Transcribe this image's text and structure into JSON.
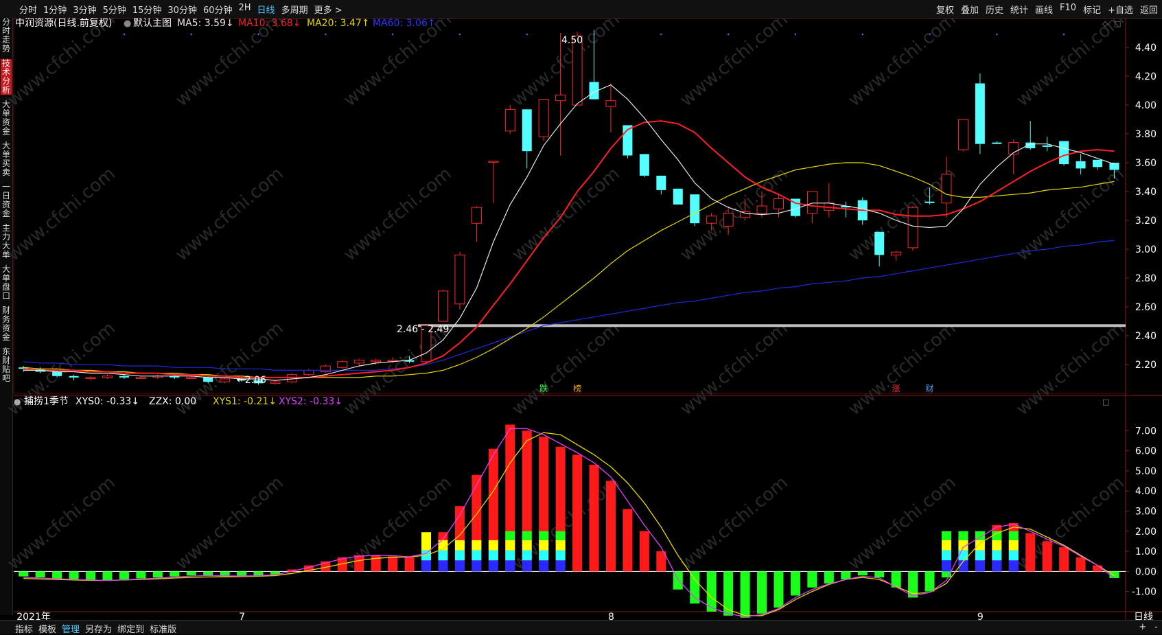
{
  "toolbar": {
    "left": [
      "分时",
      "1分钟",
      "3分钟",
      "5分钟",
      "15分钟",
      "30分钟",
      "60分钟",
      "2H",
      "日线",
      "多周期",
      "更多 >"
    ],
    "active": "日线",
    "right": [
      "复权",
      "叠加",
      "历史",
      "统计",
      "画线",
      "F10",
      "标记",
      "+自选",
      "返回"
    ]
  },
  "sidebar": [
    "分时走势",
    "技术分析",
    "大单资金",
    "大单买卖",
    "一日资金",
    "主力大单",
    "大单盘口",
    "财务资金",
    "东财贴吧"
  ],
  "sidebar_active": "技术分析",
  "bottom": {
    "left": [
      "指标",
      "模板",
      "管理",
      "另存为",
      "绑定到",
      "标准版"
    ],
    "active": "管理",
    "right_icons": [
      "+",
      "-"
    ]
  },
  "colors": {
    "up": "#ff2a2a",
    "down": "#54ffff",
    "ma5": "#e6e6e6",
    "ma10": "#ff2020",
    "ma20": "#e8d800",
    "ma60": "#1c2bd8",
    "xys1": "#e8d800",
    "xys2": "#e040fb",
    "grid": "#3a0f0f",
    "axis": "#8a1a1a"
  },
  "main_legend": {
    "name": "中润资源(日线.前复权)",
    "template": "默认主图",
    "ma5": "MA5: 3.59↓",
    "ma10": "MA10: 3.68↓",
    "ma20": "MA20: 3.47↑",
    "ma60": "MA60: 3.06↑"
  },
  "sub_legend": {
    "name": "捕捞1季节",
    "xys0": "XYS0: -0.33↓",
    "zzx": "ZZX: 0.00",
    "xys1": "XYS1: -0.21↓",
    "xys2": "XYS2: -0.33↓"
  },
  "annotations": {
    "high": "4.50",
    "low": "←2.06",
    "band": "2.46 - 2.49"
  },
  "event_markers": [
    {
      "idx": 31,
      "text": "跌",
      "color": "#33ff33"
    },
    {
      "idx": 33,
      "text": "榜",
      "color": "#ffaa00"
    },
    {
      "idx": 52,
      "text": "涨",
      "color": "#ff3333"
    },
    {
      "idx": 54,
      "text": "财",
      "color": "#4c9fff"
    }
  ],
  "watermark": "www.cfchi.com",
  "chart_data": {
    "type": "candlestick",
    "x_labels": [
      {
        "idx": 0,
        "text": "2021年"
      },
      {
        "idx": 13,
        "text": "7"
      },
      {
        "idx": 35,
        "text": "8"
      },
      {
        "idx": 57,
        "text": "9"
      }
    ],
    "period_label": "日线",
    "main_ylim": [
      2.0,
      4.5
    ],
    "main_yticks": [
      2.2,
      2.4,
      2.6,
      2.8,
      3.0,
      3.2,
      3.4,
      3.6,
      3.8,
      4.0,
      4.2,
      4.4
    ],
    "sub_ylim": [
      -1.9,
      8.0
    ],
    "sub_yticks": [
      -1.0,
      0.0,
      1.0,
      2.0,
      3.0,
      4.0,
      5.0,
      6.0,
      7.0
    ],
    "band_price": 2.47,
    "ohlc": [
      [
        2.18,
        2.19,
        2.15,
        2.17
      ],
      [
        2.17,
        2.18,
        2.14,
        2.15
      ],
      [
        2.15,
        2.16,
        2.11,
        2.12
      ],
      [
        2.12,
        2.13,
        2.09,
        2.11
      ],
      [
        2.11,
        2.12,
        2.09,
        2.11
      ],
      [
        2.11,
        2.13,
        2.1,
        2.12
      ],
      [
        2.12,
        2.13,
        2.1,
        2.11
      ],
      [
        2.11,
        2.12,
        2.1,
        2.11
      ],
      [
        2.11,
        2.13,
        2.1,
        2.12
      ],
      [
        2.12,
        2.13,
        2.1,
        2.11
      ],
      [
        2.11,
        2.12,
        2.1,
        2.11
      ],
      [
        2.11,
        2.12,
        2.07,
        2.08
      ],
      [
        2.08,
        2.11,
        2.07,
        2.1
      ],
      [
        2.1,
        2.11,
        2.08,
        2.09
      ],
      [
        2.09,
        2.1,
        2.06,
        2.07
      ],
      [
        2.07,
        2.09,
        2.06,
        2.08
      ],
      [
        2.08,
        2.14,
        2.07,
        2.13
      ],
      [
        2.13,
        2.17,
        2.12,
        2.16
      ],
      [
        2.15,
        2.2,
        2.14,
        2.19
      ],
      [
        2.18,
        2.23,
        2.17,
        2.22
      ],
      [
        2.21,
        2.24,
        2.19,
        2.23
      ],
      [
        2.22,
        2.24,
        2.2,
        2.23
      ],
      [
        2.23,
        2.25,
        2.21,
        2.23
      ],
      [
        2.23,
        2.26,
        2.21,
        2.22
      ],
      [
        2.22,
        2.47,
        2.21,
        2.47
      ],
      [
        2.5,
        2.72,
        2.5,
        2.71
      ],
      [
        2.62,
        2.98,
        2.58,
        2.96
      ],
      [
        3.18,
        3.3,
        3.05,
        3.29
      ],
      [
        3.61,
        3.61,
        3.32,
        3.61
      ],
      [
        3.82,
        4.0,
        3.8,
        3.97
      ],
      [
        3.97,
        3.97,
        3.56,
        3.68
      ],
      [
        3.78,
        4.04,
        3.75,
        4.04
      ],
      [
        4.03,
        4.5,
        3.65,
        4.07
      ],
      [
        4.0,
        4.51,
        4.0,
        4.48
      ],
      [
        4.16,
        4.52,
        4.04,
        4.04
      ],
      [
        3.99,
        4.15,
        3.81,
        4.03
      ],
      [
        3.86,
        3.86,
        3.63,
        3.65
      ],
      [
        3.66,
        3.66,
        3.5,
        3.51
      ],
      [
        3.51,
        3.51,
        3.38,
        3.41
      ],
      [
        3.42,
        3.42,
        3.33,
        3.31
      ],
      [
        3.38,
        3.38,
        3.16,
        3.18
      ],
      [
        3.18,
        3.25,
        3.13,
        3.23
      ],
      [
        3.16,
        3.3,
        3.1,
        3.25
      ],
      [
        3.22,
        3.35,
        3.2,
        3.26
      ],
      [
        3.25,
        3.4,
        3.22,
        3.3
      ],
      [
        3.28,
        3.38,
        3.22,
        3.35
      ],
      [
        3.35,
        3.35,
        3.22,
        3.23
      ],
      [
        3.25,
        3.4,
        3.18,
        3.4
      ],
      [
        3.27,
        3.46,
        3.22,
        3.32
      ],
      [
        3.3,
        3.33,
        3.22,
        3.29
      ],
      [
        3.34,
        3.36,
        3.17,
        3.2
      ],
      [
        3.12,
        3.12,
        2.88,
        2.96
      ],
      [
        2.96,
        2.99,
        2.92,
        2.98
      ],
      [
        3.01,
        3.3,
        2.99,
        3.29
      ],
      [
        3.33,
        3.43,
        3.31,
        3.32
      ],
      [
        3.32,
        3.64,
        3.22,
        3.52
      ],
      [
        3.69,
        3.9,
        3.68,
        3.9
      ],
      [
        4.15,
        4.22,
        3.66,
        3.73
      ],
      [
        3.74,
        3.75,
        3.73,
        3.73
      ],
      [
        3.66,
        3.76,
        3.52,
        3.74
      ],
      [
        3.74,
        3.89,
        3.69,
        3.7
      ],
      [
        3.72,
        3.78,
        3.68,
        3.71
      ],
      [
        3.75,
        3.75,
        3.58,
        3.59
      ],
      [
        3.61,
        3.66,
        3.52,
        3.56
      ],
      [
        3.62,
        3.62,
        3.55,
        3.57
      ],
      [
        3.6,
        3.6,
        3.49,
        3.55
      ]
    ],
    "ma5": [
      2.16,
      2.16,
      2.15,
      2.15,
      2.14,
      2.14,
      2.13,
      2.12,
      2.12,
      2.12,
      2.12,
      2.11,
      2.11,
      2.1,
      2.1,
      2.09,
      2.1,
      2.11,
      2.13,
      2.16,
      2.19,
      2.21,
      2.22,
      2.23,
      2.28,
      2.37,
      2.52,
      2.73,
      3.05,
      3.31,
      3.5,
      3.72,
      3.87,
      4.01,
      4.09,
      4.14,
      4.04,
      3.91,
      3.76,
      3.62,
      3.46,
      3.35,
      3.29,
      3.25,
      3.24,
      3.25,
      3.28,
      3.32,
      3.32,
      3.3,
      3.28,
      3.25,
      3.2,
      3.16,
      3.15,
      3.16,
      3.28,
      3.45,
      3.57,
      3.67,
      3.73,
      3.73,
      3.7,
      3.67,
      3.63,
      3.59
    ],
    "ma10": [
      2.17,
      2.16,
      2.16,
      2.16,
      2.15,
      2.15,
      2.14,
      2.14,
      2.14,
      2.13,
      2.13,
      2.12,
      2.12,
      2.11,
      2.11,
      2.11,
      2.11,
      2.11,
      2.12,
      2.13,
      2.14,
      2.15,
      2.16,
      2.18,
      2.21,
      2.26,
      2.35,
      2.46,
      2.61,
      2.76,
      2.92,
      3.08,
      3.22,
      3.4,
      3.54,
      3.7,
      3.83,
      3.88,
      3.89,
      3.87,
      3.81,
      3.7,
      3.6,
      3.5,
      3.43,
      3.38,
      3.32,
      3.3,
      3.29,
      3.28,
      3.27,
      3.27,
      3.24,
      3.23,
      3.23,
      3.24,
      3.28,
      3.33,
      3.4,
      3.47,
      3.54,
      3.6,
      3.65,
      3.68,
      3.69,
      3.68
    ],
    "ma20": [
      2.18,
      2.17,
      2.17,
      2.16,
      2.16,
      2.15,
      2.15,
      2.14,
      2.14,
      2.14,
      2.13,
      2.13,
      2.12,
      2.12,
      2.11,
      2.11,
      2.11,
      2.11,
      2.11,
      2.11,
      2.11,
      2.12,
      2.12,
      2.13,
      2.14,
      2.16,
      2.2,
      2.25,
      2.31,
      2.38,
      2.45,
      2.53,
      2.62,
      2.71,
      2.8,
      2.9,
      2.99,
      3.06,
      3.13,
      3.19,
      3.25,
      3.31,
      3.37,
      3.42,
      3.47,
      3.51,
      3.55,
      3.57,
      3.59,
      3.6,
      3.6,
      3.58,
      3.54,
      3.5,
      3.45,
      3.38,
      3.36,
      3.36,
      3.37,
      3.38,
      3.39,
      3.41,
      3.42,
      3.43,
      3.45,
      3.47
    ],
    "ma60": [
      2.22,
      2.21,
      2.21,
      2.2,
      2.2,
      2.2,
      2.19,
      2.19,
      2.19,
      2.18,
      2.18,
      2.18,
      2.17,
      2.17,
      2.17,
      2.16,
      2.16,
      2.16,
      2.16,
      2.16,
      2.16,
      2.16,
      2.17,
      2.18,
      2.2,
      2.23,
      2.27,
      2.31,
      2.35,
      2.39,
      2.43,
      2.47,
      2.49,
      2.51,
      2.53,
      2.55,
      2.57,
      2.59,
      2.61,
      2.63,
      2.64,
      2.66,
      2.68,
      2.7,
      2.71,
      2.73,
      2.74,
      2.76,
      2.77,
      2.78,
      2.8,
      2.81,
      2.83,
      2.85,
      2.87,
      2.89,
      2.91,
      2.93,
      2.95,
      2.97,
      2.99,
      3.0,
      3.02,
      3.03,
      3.05,
      3.06
    ],
    "xys0": [
      -0.25,
      -0.3,
      -0.35,
      -0.4,
      -0.45,
      -0.45,
      -0.4,
      -0.35,
      -0.3,
      -0.25,
      -0.2,
      -0.2,
      -0.25,
      -0.25,
      -0.2,
      -0.15,
      0.1,
      0.3,
      0.5,
      0.7,
      0.8,
      0.8,
      0.75,
      0.7,
      1.0,
      1.95,
      3.25,
      4.8,
      6.1,
      7.3,
      7.0,
      6.7,
      6.2,
      5.8,
      5.3,
      4.5,
      3.1,
      2.0,
      1.0,
      -0.9,
      -1.6,
      -2.0,
      -2.2,
      -2.3,
      -2.1,
      -1.8,
      -1.2,
      -0.8,
      -0.6,
      -0.4,
      -0.2,
      -0.3,
      -0.8,
      -1.3,
      -1.0,
      -0.3,
      1.8,
      1.9,
      2.3,
      2.4,
      1.9,
      1.5,
      1.2,
      0.7,
      0.3,
      -0.33
    ],
    "xys1": [
      -0.35,
      -0.38,
      -0.4,
      -0.43,
      -0.45,
      -0.45,
      -0.43,
      -0.4,
      -0.37,
      -0.33,
      -0.3,
      -0.28,
      -0.27,
      -0.26,
      -0.24,
      -0.21,
      -0.1,
      0.05,
      0.2,
      0.38,
      0.54,
      0.65,
      0.7,
      0.72,
      0.8,
      1.12,
      1.8,
      2.85,
      4.0,
      5.4,
      6.5,
      6.9,
      6.8,
      6.3,
      5.8,
      5.2,
      4.4,
      3.4,
      2.2,
      0.8,
      -0.4,
      -1.3,
      -1.9,
      -2.2,
      -2.2,
      -1.9,
      -1.4,
      -1.0,
      -0.65,
      -0.4,
      -0.3,
      -0.4,
      -0.75,
      -1.1,
      -1.05,
      -0.6,
      0.5,
      1.4,
      1.9,
      2.2,
      2.1,
      1.7,
      1.3,
      0.8,
      0.3,
      -0.21
    ],
    "xys2": [
      -0.3,
      -0.33,
      -0.36,
      -0.4,
      -0.43,
      -0.45,
      -0.42,
      -0.38,
      -0.33,
      -0.28,
      -0.23,
      -0.21,
      -0.22,
      -0.23,
      -0.21,
      -0.17,
      0.0,
      0.2,
      0.42,
      0.63,
      0.76,
      0.8,
      0.78,
      0.73,
      0.9,
      1.6,
      2.8,
      4.3,
      5.8,
      7.1,
      7.1,
      6.8,
      6.35,
      5.9,
      5.4,
      4.7,
      3.5,
      2.3,
      1.2,
      -0.4,
      -1.3,
      -1.8,
      -2.1,
      -2.25,
      -2.15,
      -1.85,
      -1.3,
      -0.9,
      -0.62,
      -0.4,
      -0.24,
      -0.32,
      -0.78,
      -1.22,
      -1.05,
      -0.45,
      1.2,
      1.7,
      2.2,
      2.35,
      2.0,
      1.6,
      1.25,
      0.75,
      0.3,
      -0.33
    ],
    "layered_bars": [
      {
        "idx": 24,
        "values": [
          0.55,
          1.05,
          1.95
        ]
      },
      {
        "idx": 25,
        "values": [
          0.55,
          1.05,
          1.55
        ]
      },
      {
        "idx": 26,
        "values": [
          0.55,
          1.05,
          1.55
        ]
      },
      {
        "idx": 27,
        "values": [
          0.55,
          1.05,
          1.55
        ]
      },
      {
        "idx": 28,
        "values": [
          0.55,
          1.05,
          1.55
        ]
      },
      {
        "idx": 29,
        "values": [
          0.55,
          1.05,
          1.55,
          2.0
        ]
      },
      {
        "idx": 30,
        "values": [
          0.55,
          1.05,
          1.55,
          2.0
        ]
      },
      {
        "idx": 31,
        "values": [
          0.55,
          1.05,
          1.55,
          2.0
        ]
      },
      {
        "idx": 32,
        "values": [
          0.55,
          1.05,
          1.55,
          2.0
        ]
      },
      {
        "idx": 55,
        "values": [
          0.55,
          1.05,
          1.55,
          2.0
        ]
      },
      {
        "idx": 56,
        "values": [
          0.55,
          1.05,
          1.55,
          2.0
        ]
      },
      {
        "idx": 57,
        "values": [
          0.55,
          1.05,
          1.55,
          2.0
        ]
      },
      {
        "idx": 58,
        "values": [
          0.55,
          1.05,
          1.55,
          2.0
        ]
      },
      {
        "idx": 59,
        "values": [
          0.55,
          1.05,
          1.55,
          2.0
        ]
      }
    ],
    "layer_colors": [
      "#2a2aff",
      "#2affff",
      "#ffff00",
      "#1aff1a"
    ]
  }
}
